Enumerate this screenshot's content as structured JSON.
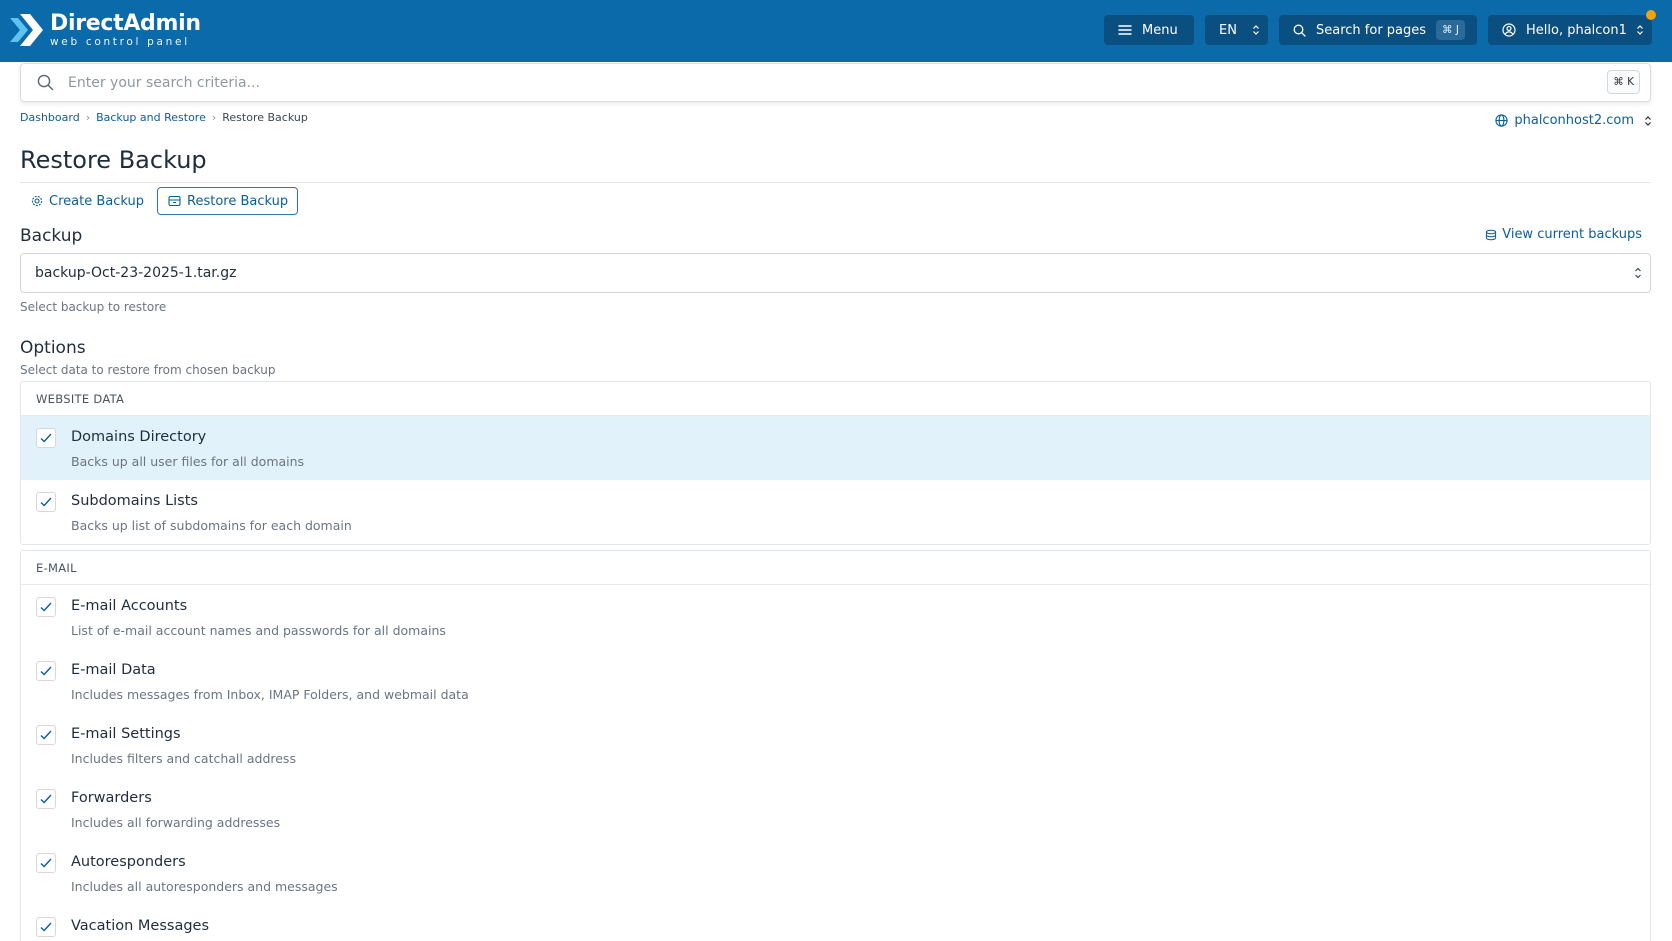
{
  "brand": {
    "title": "DirectAdmin",
    "subtitle": "web control panel",
    "color": "#0b6aa9",
    "logo_icon": "directadmin-chevron-logo"
  },
  "topbar": {
    "menu_label": "Menu",
    "menu_icon": "hamburger-icon",
    "lang_label": "EN",
    "search_label": "Search for pages",
    "search_kbd": "⌘ J",
    "user_label": "Hello, phalcon1",
    "user_icon": "user-circle-icon"
  },
  "search": {
    "placeholder": "Enter your search criteria...",
    "kbd": "⌘ K"
  },
  "breadcrumb": {
    "items": [
      "Dashboard",
      "Backup and Restore",
      "Restore Backup"
    ]
  },
  "domain_selector": {
    "value": "phalconhost2.com",
    "icon": "globe-icon"
  },
  "page": {
    "title": "Restore Backup"
  },
  "tabs": [
    {
      "label": "Create Backup",
      "icon": "gear-icon",
      "active": false
    },
    {
      "label": "Restore Backup",
      "icon": "archive-icon",
      "active": true
    }
  ],
  "backup": {
    "heading": "Backup",
    "view_link": "View current backups",
    "selected": "backup-Oct-23-2025-1.tar.gz",
    "help": "Select backup to restore"
  },
  "options": {
    "heading": "Options",
    "help": "Select data to restore from chosen backup",
    "groups": [
      {
        "title": "WEBSITE DATA",
        "items": [
          {
            "label": "Domains Directory",
            "desc": "Backs up all user files for all domains",
            "checked": true
          },
          {
            "label": "Subdomains Lists",
            "desc": "Backs up list of subdomains for each domain",
            "checked": true
          }
        ]
      },
      {
        "title": "E-MAIL",
        "items": [
          {
            "label": "E-mail Accounts",
            "desc": "List of e-mail account names and passwords for all domains",
            "checked": true
          },
          {
            "label": "E-mail Data",
            "desc": "Includes messages from Inbox, IMAP Folders, and webmail data",
            "checked": true
          },
          {
            "label": "E-mail Settings",
            "desc": "Includes filters and catchall address",
            "checked": true
          },
          {
            "label": "Forwarders",
            "desc": "Includes all forwarding addresses",
            "checked": true
          },
          {
            "label": "Autoresponders",
            "desc": "Includes all autoresponders and messages",
            "checked": true
          },
          {
            "label": "Vacation Messages",
            "checked": true
          }
        ]
      }
    ]
  },
  "colors": {
    "accent": "#0b5e96",
    "highlight_row": "#e2f2fb",
    "notification": "#f0a30a"
  }
}
